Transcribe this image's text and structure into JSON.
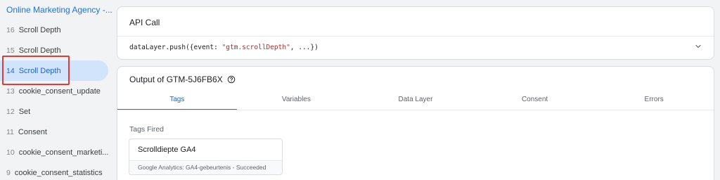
{
  "sidebar": {
    "container_title": "Online Marketing Agency -...",
    "events": [
      {
        "num": "16",
        "label": "Scroll Depth"
      },
      {
        "num": "15",
        "label": "Scroll Depth"
      },
      {
        "num": "14",
        "label": "Scroll Depth"
      },
      {
        "num": "13",
        "label": "cookie_consent_update"
      },
      {
        "num": "12",
        "label": "Set"
      },
      {
        "num": "11",
        "label": "Consent"
      },
      {
        "num": "10",
        "label": "cookie_consent_marketi..."
      },
      {
        "num": "9",
        "label": "cookie_consent_statistics"
      }
    ],
    "selected_index": 2
  },
  "api_call": {
    "title": "API Call",
    "code_prefix": "dataLayer.push({event: ",
    "code_string": "\"gtm.scrollDepth\"",
    "code_suffix": ", ...})"
  },
  "output": {
    "title": "Output of GTM-5J6FB6X",
    "tabs": [
      "Tags",
      "Variables",
      "Data Layer",
      "Consent",
      "Errors"
    ],
    "active_tab": "Tags",
    "section_label": "Tags Fired",
    "tag": {
      "name": "Scrolldiepte GA4",
      "status": "Google Analytics: GA4-gebeurtenis - Succeeded"
    }
  },
  "colors": {
    "accent": "#1a73e8",
    "selected_bg": "#d2e3fc",
    "highlight": "#e53935",
    "code_string": "#c5221f"
  },
  "icons": {
    "expand": "chevron-down-icon",
    "help": "help-circle-icon"
  }
}
